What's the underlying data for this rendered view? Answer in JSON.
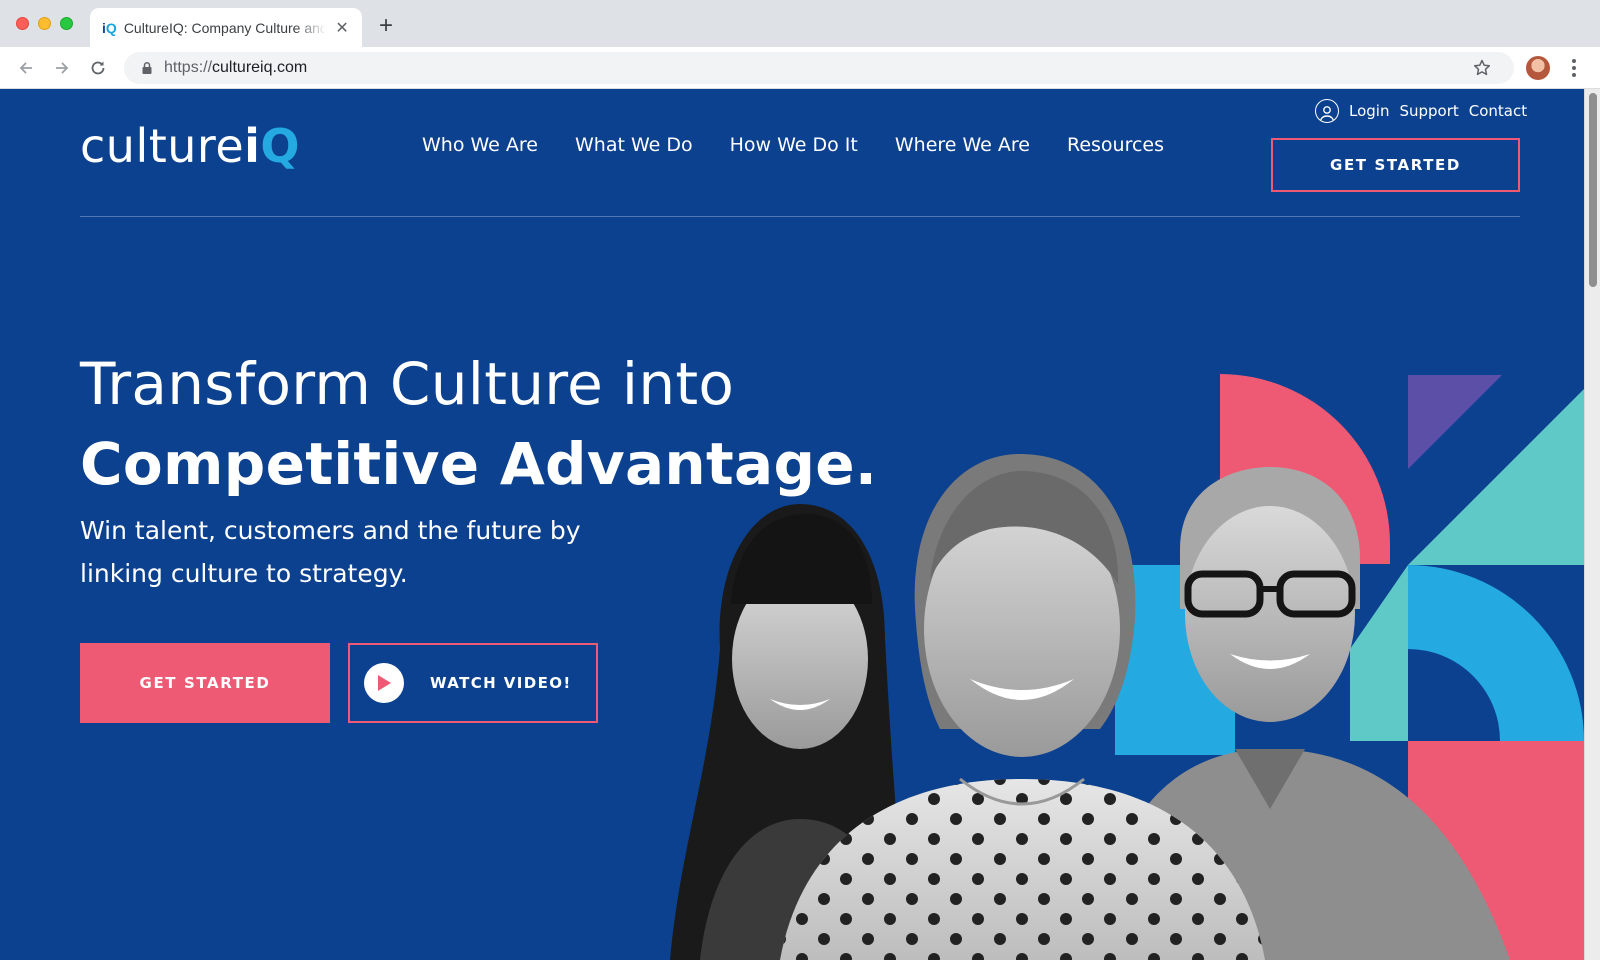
{
  "browser": {
    "tab_favicon_i": "i",
    "tab_favicon_q": "Q",
    "tab_title": "CultureIQ: Company Culture and Employee Engagement",
    "url_scheme": "https://",
    "url_host": "cultureiq.com",
    "icons": [
      "back-arrow-icon",
      "forward-arrow-icon",
      "reload-icon",
      "lock-icon",
      "star-icon",
      "profile-avatar",
      "more-vert-icon",
      "close-icon",
      "plus-icon"
    ]
  },
  "site": {
    "logo_text": "culture",
    "logo_i": "i",
    "logo_q": "Q",
    "nav": [
      "Who We Are",
      "What We Do",
      "How We Do It",
      "Where We Are",
      "Resources"
    ],
    "utility": {
      "login": "Login",
      "support": "Support",
      "contact": "Contact"
    },
    "header_cta": "GET STARTED"
  },
  "hero": {
    "headline_line1": "Transform Culture into",
    "headline_line2": "Competitive Advantage.",
    "subhead": "Win talent, customers and the future by linking culture to strategy.",
    "primary_cta": "GET STARTED",
    "video_cta": "WATCH VIDEO!"
  },
  "colors": {
    "brand_blue": "#0c4190",
    "accent_pink": "#ee5a74",
    "accent_cyan": "#24a9e1",
    "accent_teal": "#5ec9c6",
    "accent_violet": "#5b4fa8"
  }
}
